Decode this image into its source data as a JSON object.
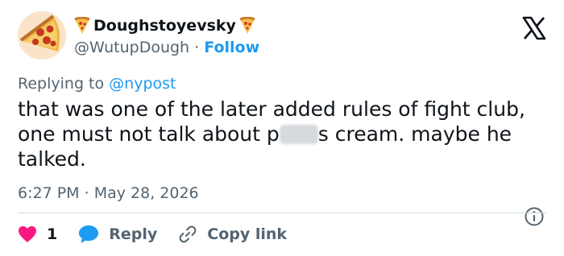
{
  "author": {
    "display_name": "Doughstoyevsky",
    "handle": "@WutupDough",
    "separator": "·",
    "follow_label": "Follow",
    "avatar_icon": "pizza-avatar",
    "name_decoration_icon": "pizza-emoji"
  },
  "reply_context": {
    "prefix": "Replying to",
    "mention": "@nypost"
  },
  "tweet": {
    "text_before_blur": "that was one of the later added rules of fight club, one must not talk about p",
    "text_after_blur": "s cream.  maybe he talked."
  },
  "meta": {
    "time": "6:27 PM",
    "separator": "·",
    "date": "May 28, 2026"
  },
  "actions": {
    "like_count": "1",
    "reply_label": "Reply",
    "copy_link_label": "Copy link"
  },
  "colors": {
    "accent": "#1d9bf0",
    "like": "#f91880",
    "text": "#0f1419",
    "muted": "#536471"
  }
}
